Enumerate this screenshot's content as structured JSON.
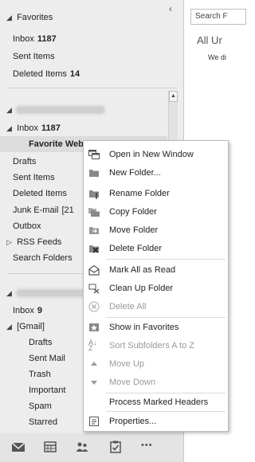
{
  "pane": {
    "collapse_glyph": "‹",
    "favorites": {
      "header": "Favorites",
      "items": [
        {
          "label": "Inbox",
          "count": "1187"
        },
        {
          "label": "Sent Items",
          "count": ""
        },
        {
          "label": "Deleted Items",
          "count": "14"
        }
      ]
    },
    "account1": {
      "inbox": {
        "label": "Inbox",
        "count": "1187"
      },
      "selected": "Favorite Web Comics",
      "folders": [
        {
          "label": "Drafts",
          "count": ""
        },
        {
          "label": "Sent Items",
          "count": ""
        },
        {
          "label": "Deleted Items",
          "count": ""
        },
        {
          "label": "Junk E-mail",
          "count": "[21"
        },
        {
          "label": "Outbox",
          "count": ""
        }
      ],
      "rss": "RSS Feeds",
      "search_folders": "Search Folders"
    },
    "account2": {
      "inbox": {
        "label": "Inbox",
        "count": "9"
      },
      "gmail": {
        "label": "[Gmail]",
        "folders": [
          "Drafts",
          "Sent Mail",
          "Trash",
          "Important",
          "Spam",
          "Starred"
        ]
      }
    }
  },
  "nav": {
    "icons": [
      "mail-icon",
      "calendar-icon",
      "people-icon",
      "tasks-icon",
      "more-icon"
    ],
    "more_label": "•••"
  },
  "right": {
    "search_placeholder": "Search F",
    "filter": "All  Ur",
    "message_info": "We di"
  },
  "context_menu": {
    "items": [
      {
        "label": "Open in New Window",
        "icon": "new-window-icon",
        "disabled": false
      },
      {
        "label": "New Folder...",
        "icon": "new-folder-icon",
        "disabled": false
      },
      {
        "label": "Rename Folder",
        "icon": "rename-folder-icon",
        "disabled": false
      },
      {
        "label": "Copy Folder",
        "icon": "copy-folder-icon",
        "disabled": false
      },
      {
        "label": "Move Folder",
        "icon": "move-folder-icon",
        "disabled": false
      },
      {
        "label": "Delete Folder",
        "icon": "delete-folder-icon",
        "disabled": false
      },
      {
        "label": "Mark All as Read",
        "icon": "mark-read-icon",
        "disabled": false
      },
      {
        "label": "Clean Up Folder",
        "icon": "clean-up-icon",
        "disabled": false
      },
      {
        "label": "Delete All",
        "icon": "delete-all-icon",
        "disabled": true
      },
      {
        "label": "Show in Favorites",
        "icon": "favorites-icon",
        "disabled": false
      },
      {
        "label": "Sort Subfolders A to Z",
        "icon": "sort-az-icon",
        "disabled": true
      },
      {
        "label": "Move Up",
        "icon": "move-up-icon",
        "disabled": true
      },
      {
        "label": "Move Down",
        "icon": "move-down-icon",
        "disabled": true
      },
      {
        "label": "Process Marked Headers",
        "icon": "",
        "disabled": false
      },
      {
        "label": "Properties...",
        "icon": "properties-icon",
        "disabled": false
      }
    ]
  }
}
